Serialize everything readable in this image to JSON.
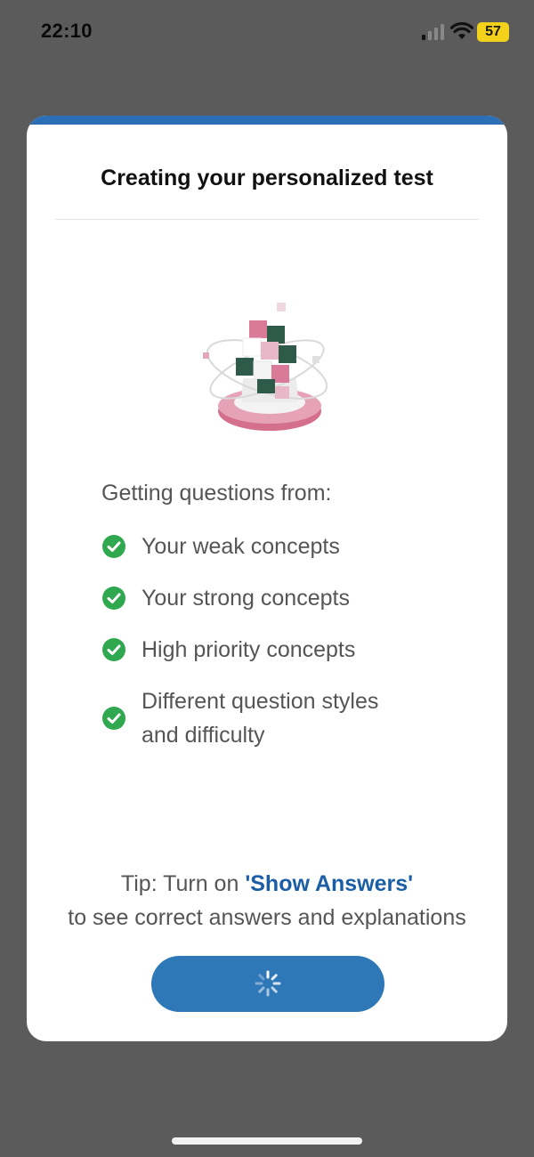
{
  "status_bar": {
    "time": "22:10",
    "battery_level": "57",
    "icons": [
      "cellular-signal-icon",
      "wifi-icon",
      "battery-icon"
    ]
  },
  "modal": {
    "title": "Creating your personalized test",
    "illustration": "cube-orbit-illustration",
    "intro": "Getting questions from:",
    "concepts": [
      {
        "label": "Your weak concepts"
      },
      {
        "label": "Your strong concepts"
      },
      {
        "label": "High priority concepts"
      },
      {
        "label_line1": "Different question styles",
        "label_line2": "and difficulty"
      }
    ],
    "tip": {
      "prefix": "Tip: Turn on ",
      "link": "'Show Answers'",
      "suffix": "to see correct answers and explanations"
    },
    "loading_button": {
      "icon": "spinner-icon",
      "state": "loading"
    }
  },
  "colors": {
    "backdrop": "#5b5b5b",
    "card_accent": "#2d6fb7",
    "button": "#2f78b8",
    "check": "#2fa84f",
    "link": "#1b5ea6",
    "battery": "#f4d21c"
  }
}
